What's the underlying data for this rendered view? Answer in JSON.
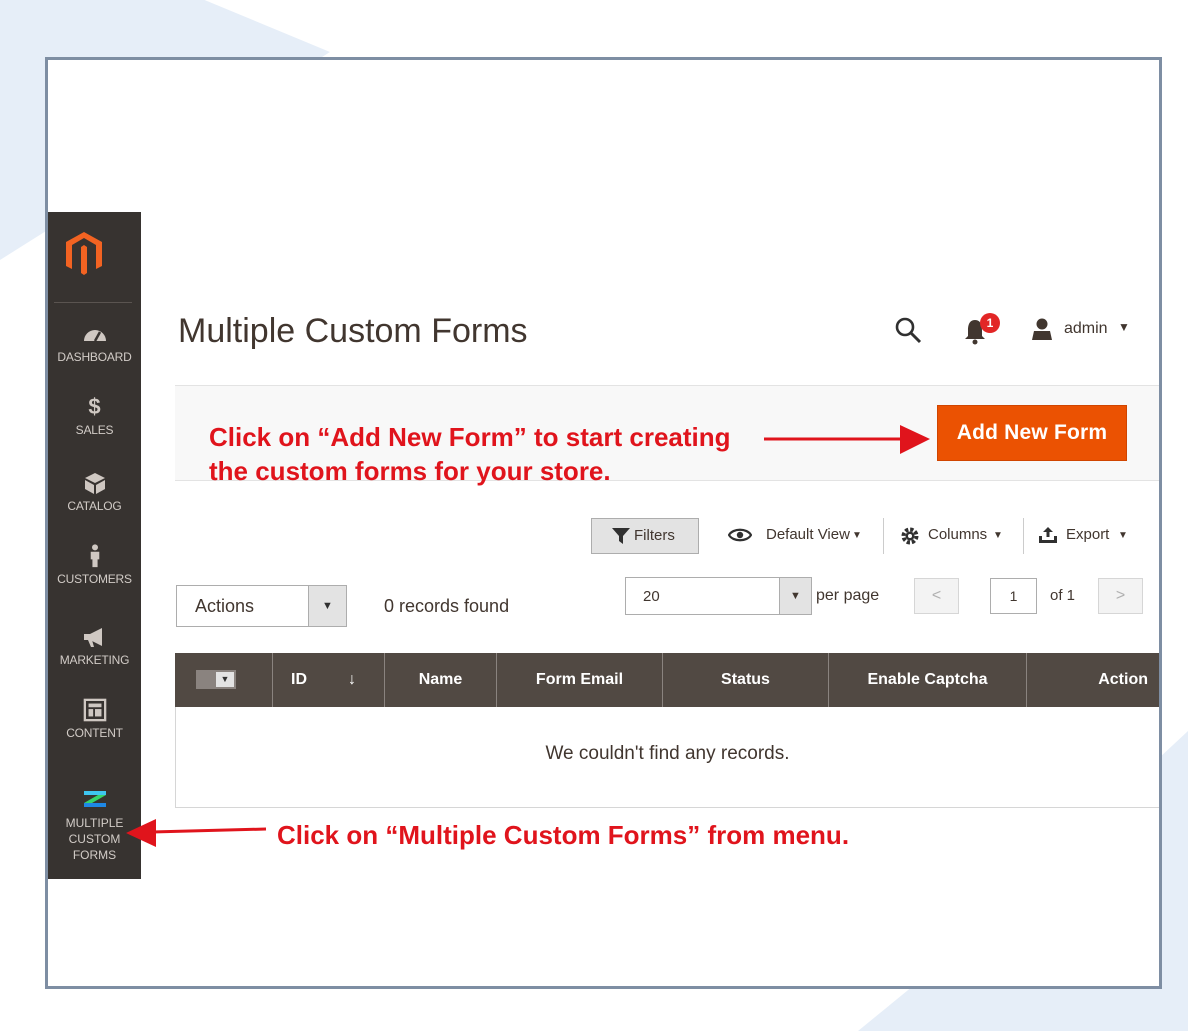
{
  "sidebar": {
    "items": [
      {
        "label": "DASHBOARD",
        "icon": "dashboard-gauge-icon"
      },
      {
        "label": "SALES",
        "icon": "dollar-icon"
      },
      {
        "label": "CATALOG",
        "icon": "cube-icon"
      },
      {
        "label": "CUSTOMERS",
        "icon": "person-icon"
      },
      {
        "label": "MARKETING",
        "icon": "megaphone-icon"
      },
      {
        "label": "CONTENT",
        "icon": "layout-icon"
      }
    ],
    "extension": {
      "line1": "MULTIPLE",
      "line2": "CUSTOM",
      "line3": "FORMS",
      "icon": "extension-z-icon"
    }
  },
  "header": {
    "title": "Multiple Custom Forms",
    "notification_count": "1",
    "user": "admin"
  },
  "action_bar": {
    "add_button": "Add New Form"
  },
  "annotations": {
    "add_form_line1": "Click on “Add New Form” to start creating",
    "add_form_line2": "the custom forms for your store.",
    "menu_hint": "Click on “Multiple Custom Forms” from menu.",
    "color": "#e0141c"
  },
  "toolbar": {
    "filters": "Filters",
    "view": "Default View",
    "columns": "Columns",
    "export": "Export"
  },
  "grid_controls": {
    "actions": "Actions",
    "records_found": "0 records found",
    "per_page_value": "20",
    "per_page_label": "per page",
    "current_page": "1",
    "of_pages": "of 1"
  },
  "grid": {
    "columns": [
      "ID",
      "Name",
      "Form Email",
      "Status",
      "Enable Captcha",
      "Action"
    ],
    "empty_message": "We couldn't find any records."
  },
  "colors": {
    "accent": "#eb5202",
    "sidebar": "#373330",
    "grid_header": "#514943"
  }
}
